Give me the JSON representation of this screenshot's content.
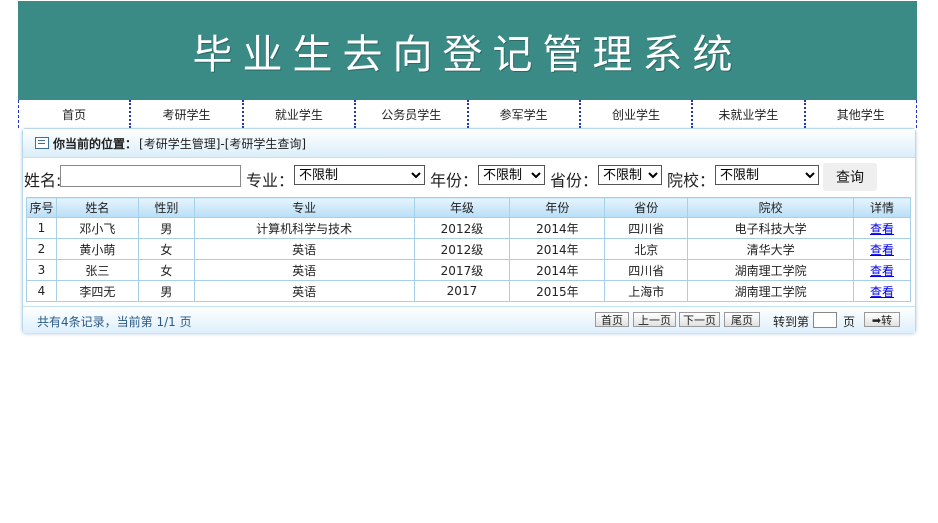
{
  "banner": {
    "title": "毕业生去向登记管理系统"
  },
  "nav": {
    "items": [
      "首页",
      "考研学生",
      "就业学生",
      "公务员学生",
      "参军学生",
      "创业学生",
      "未就业学生",
      "其他学生"
    ]
  },
  "location": {
    "label": "你当前的位置：",
    "path": "[考研学生管理]-[考研学生查询]"
  },
  "search": {
    "name_label": "姓名:",
    "name_value": "",
    "major_label": "专业：",
    "major_value": "不限制",
    "year_label": "年份：",
    "year_value": "不限制",
    "province_label": "省份：",
    "province_value": "不限制",
    "school_label": "院校：",
    "school_value": "不限制",
    "query_button": "查询"
  },
  "table": {
    "headers": [
      "序号",
      "姓名",
      "性别",
      "专业",
      "年级",
      "年份",
      "省份",
      "院校",
      "详情"
    ],
    "rows": [
      [
        "1",
        "邓小飞",
        "男",
        "计算机科学与技术",
        "2012级",
        "2014年",
        "四川省",
        "电子科技大学",
        "查看"
      ],
      [
        "2",
        "黄小萌",
        "女",
        "英语",
        "2012级",
        "2014年",
        "北京",
        "清华大学",
        "查看"
      ],
      [
        "3",
        "张三",
        "女",
        "英语",
        "2017级",
        "2014年",
        "四川省",
        "湖南理工学院",
        "查看"
      ],
      [
        "4",
        "李四无",
        "男",
        "英语",
        "2017",
        "2015年",
        "上海市",
        "湖南理工学院",
        "查看"
      ]
    ]
  },
  "pager": {
    "info": "共有4条记录，当前第 1/1 页",
    "first": "首页",
    "prev": "上一页",
    "next": "下一页",
    "last": "尾页",
    "goto_label": "转到第",
    "page_unit": "页",
    "goto_button": "➡转",
    "goto_value": ""
  }
}
